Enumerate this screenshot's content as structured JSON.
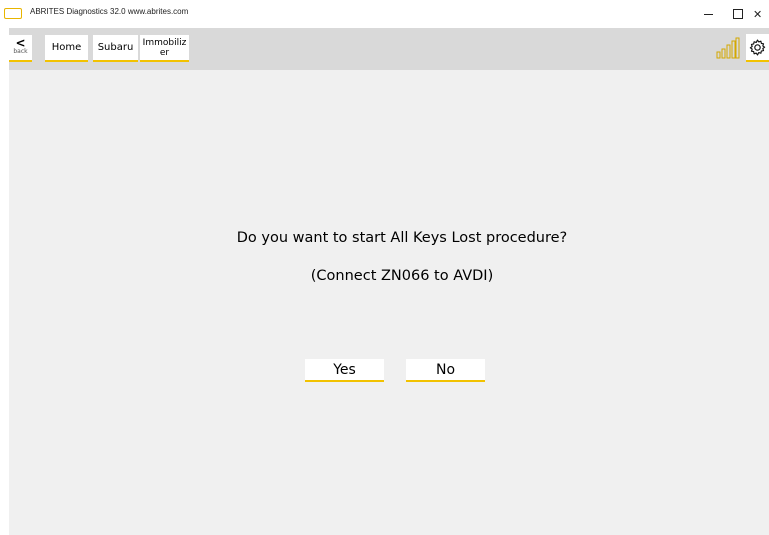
{
  "window": {
    "title": "ABRITES Diagnostics 32.0   www.abrites.com",
    "minimize_glyph": "–",
    "close_glyph": "✕"
  },
  "toolbar": {
    "back_chevron": "<",
    "back_label": "back",
    "breadcrumbs": [
      "Home",
      "Subaru",
      "Immobilizer"
    ],
    "signal_icon": "signal-bars-icon",
    "settings_icon": "gear-icon",
    "accent_color": "#f2c200"
  },
  "dialog": {
    "question": "Do you want to start All Keys Lost procedure?",
    "subtext": "(Connect ZN066 to AVDI)",
    "yes_label": "Yes",
    "no_label": "No"
  }
}
